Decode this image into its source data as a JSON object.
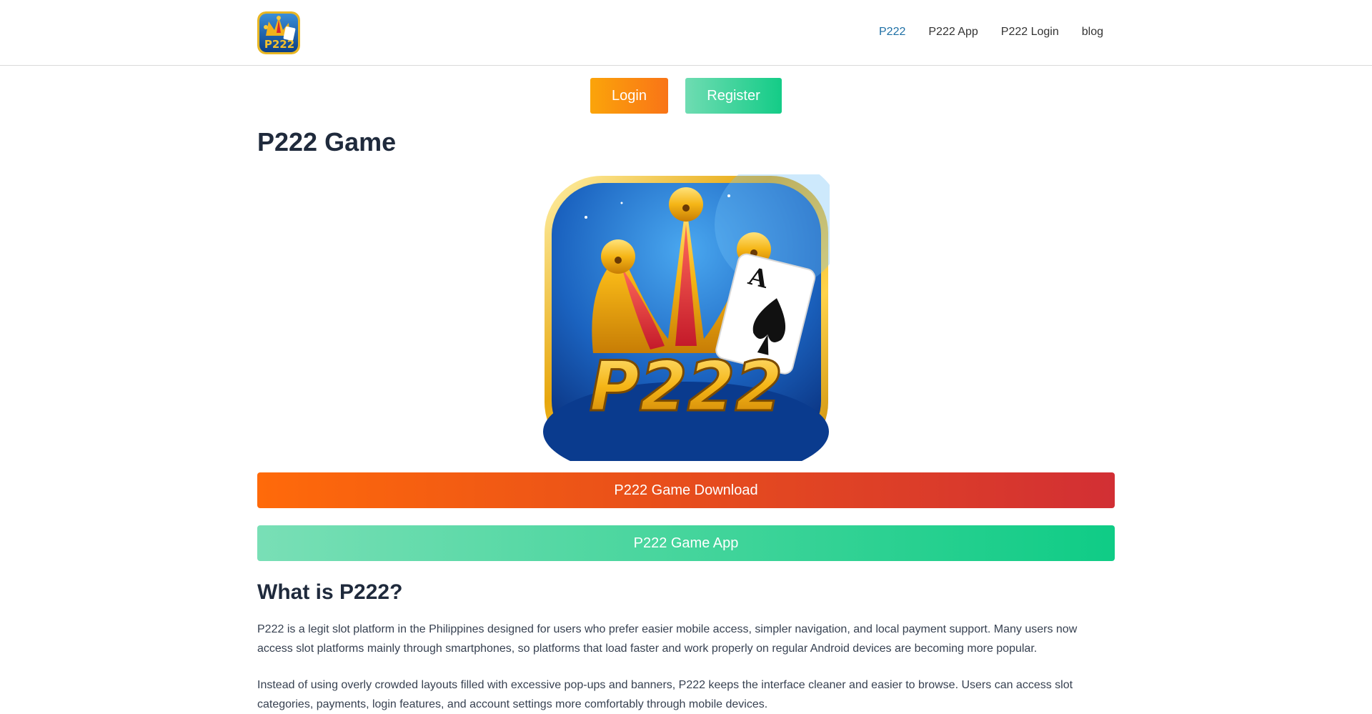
{
  "header": {
    "logo_text": "P222",
    "nav": [
      {
        "label": "P222",
        "active": true
      },
      {
        "label": "P222 App",
        "active": false
      },
      {
        "label": "P222 Login",
        "active": false
      },
      {
        "label": "blog",
        "active": false
      }
    ]
  },
  "auth": {
    "login_label": "Login",
    "register_label": "Register"
  },
  "main": {
    "title": "P222 Game",
    "hero_logo_text": "P222",
    "hero_card_letter": "A",
    "download_label": "P222 Game Download",
    "app_label": "P222 Game App",
    "section_title": "What is P222?",
    "paragraphs": [
      "P222 is a legit slot platform in the Philippines designed for users who prefer easier mobile access, simpler navigation, and local payment support. Many users now access slot platforms mainly through smartphones, so platforms that load faster and work properly on regular Android devices are becoming more popular.",
      "Instead of using overly crowded layouts filled with excessive pop-ups and banners, P222 keeps the interface cleaner and easier to browse. Users can access slot categories, payments, login features, and account settings more comfortably through mobile devices."
    ]
  },
  "colors": {
    "nav_active": "#1d6fa5",
    "login_start": "#fba40a",
    "login_end": "#f97417",
    "register_start": "#6fdcb2",
    "register_end": "#14cc87",
    "download_start": "#ff6a0a",
    "download_end": "#d22f34",
    "app_start": "#79dfb6",
    "app_end": "#0fcc86"
  },
  "icons": {
    "logo": "jester-crown-icon",
    "hero": "p222-app-icon"
  }
}
